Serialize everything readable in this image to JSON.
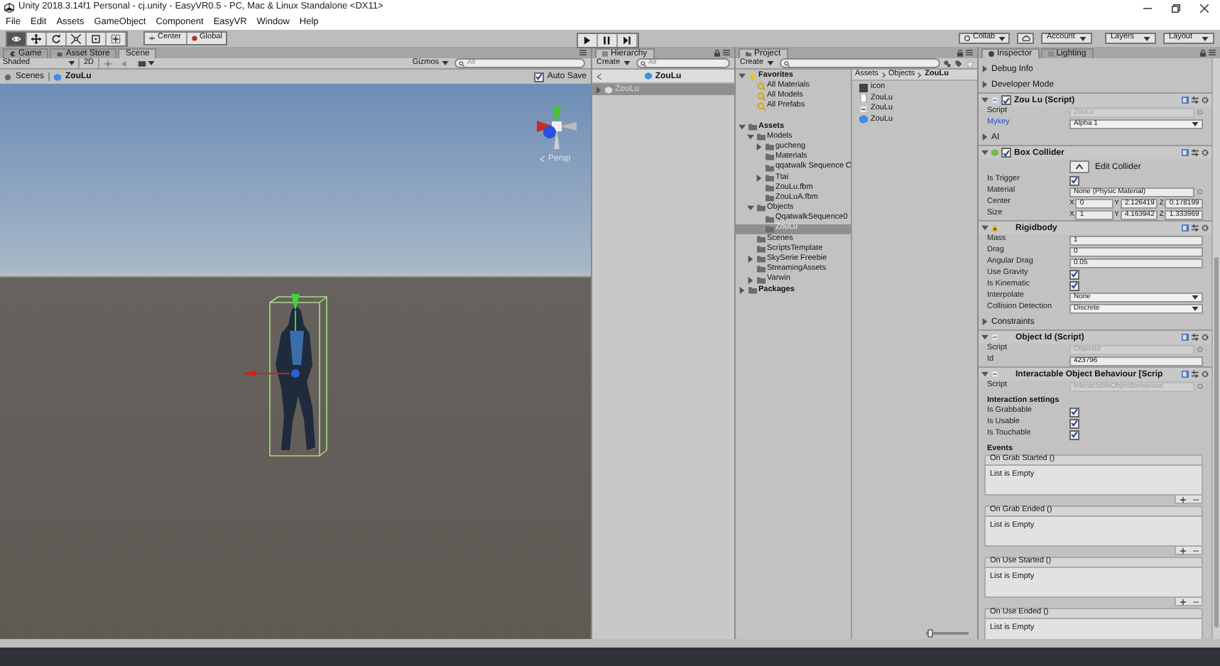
{
  "window": {
    "title": "Unity 2018.3.14f1 Personal - cj.unity - EasyVR0.5 - PC, Mac & Linux Standalone <DX11>"
  },
  "menu": [
    "File",
    "Edit",
    "Assets",
    "GameObject",
    "Component",
    "EasyVR",
    "Window",
    "Help"
  ],
  "toolbar": {
    "tools": [
      {
        "kind": "view",
        "selected": true
      },
      {
        "kind": "move",
        "selected": false
      },
      {
        "kind": "rotate",
        "selected": false
      },
      {
        "kind": "scale",
        "selected": false
      },
      {
        "kind": "rect",
        "selected": false
      },
      {
        "kind": "transform",
        "selected": false
      }
    ],
    "pivot": "Center",
    "space": "Global",
    "play": [
      {
        "kind": "play"
      },
      {
        "kind": "pause"
      },
      {
        "kind": "step"
      }
    ],
    "collab": "Collab",
    "account": "Account",
    "layers": "Layers",
    "layout": "Layout"
  },
  "scene": {
    "tabs": [
      {
        "label": "Game",
        "kind": "game",
        "selected": false
      },
      {
        "label": "Asset Store",
        "kind": "store",
        "selected": false
      },
      {
        "label": "Scene",
        "kind": "scene",
        "selected": true
      }
    ],
    "shading": "Shaded",
    "mode_2d": "2D",
    "gizmos": "Gizmos",
    "search": {
      "placeholder": "All"
    },
    "breadcrumb": [
      "Scenes",
      "ZouLu"
    ],
    "auto_save": {
      "label": "Auto Save",
      "checked": true
    },
    "projection": "Persp"
  },
  "hierarchy": {
    "tab": "Hierarchy",
    "create": "Create",
    "search": {
      "placeholder": "All"
    },
    "scene_header": "ZouLu",
    "items": [
      {
        "label": "ZouLu",
        "selected": true,
        "expanded": false
      }
    ]
  },
  "project": {
    "tab": "Project",
    "create": "Create",
    "tree": [
      {
        "label": "Favorites",
        "kind": "favorites",
        "expanded": true,
        "children": [
          {
            "label": "All Materials",
            "kind": "search"
          },
          {
            "label": "All Models",
            "kind": "search"
          },
          {
            "label": "All Prefabs",
            "kind": "search"
          }
        ]
      },
      {
        "label": "Assets",
        "kind": "root",
        "expanded": true,
        "children": [
          {
            "label": "Models",
            "kind": "folder",
            "expanded": true,
            "children": [
              {
                "label": "gucheng",
                "kind": "folder",
                "expanded": false
              },
              {
                "label": "Materials",
                "kind": "folder"
              },
              {
                "label": "qqatwalk Sequence C",
                "kind": "folder"
              },
              {
                "label": "Ttai",
                "kind": "folder",
                "expanded": false
              },
              {
                "label": "ZouLu.fbm",
                "kind": "folder"
              },
              {
                "label": "ZouLuA.fbm",
                "kind": "folder"
              }
            ]
          },
          {
            "label": "Objects",
            "kind": "folder",
            "expanded": true,
            "children": [
              {
                "label": "QqatwalkSequence0",
                "kind": "folder"
              },
              {
                "label": "ZouLu",
                "kind": "folder",
                "selected": true
              }
            ]
          },
          {
            "label": "Scenes",
            "kind": "folder"
          },
          {
            "label": "ScriptsTemplate",
            "kind": "folder"
          },
          {
            "label": "SkySerie Freebie",
            "kind": "folder",
            "expanded": false
          },
          {
            "label": "StreamingAssets",
            "kind": "folder"
          },
          {
            "label": "Varwin",
            "kind": "folder",
            "expanded": false
          }
        ]
      },
      {
        "label": "Packages",
        "kind": "root",
        "expanded": false
      }
    ],
    "path": [
      "Assets",
      "Objects",
      "ZouLu"
    ],
    "zoom_slider": {
      "level": 0.05
    },
    "files": [
      {
        "label": "icon",
        "kind": "image"
      },
      {
        "label": "ZouLu",
        "kind": "document"
      },
      {
        "label": "ZouLu",
        "kind": "script"
      },
      {
        "label": "ZouLu",
        "kind": "prefab"
      }
    ]
  },
  "inspector": {
    "tabs": [
      {
        "label": "Inspector",
        "selected": true
      },
      {
        "label": "Lighting",
        "selected": false
      }
    ],
    "items": [
      {
        "kind": "foldout",
        "label": "Debug Info",
        "expanded": false
      },
      {
        "kind": "foldout",
        "label": "Developer Mode",
        "expanded": false
      },
      {
        "kind": "component",
        "title": "Zou Lu (Script)",
        "enabled": true,
        "expanded": true,
        "fields": [
          {
            "kind": "object",
            "label": "Script",
            "value": "ZouLu",
            "disabled": true
          },
          {
            "kind": "dropdown",
            "label": "Mykey",
            "value": "Alpha 1",
            "overridden": true
          }
        ]
      },
      {
        "kind": "foldout",
        "label": "AI",
        "expanded": false
      },
      {
        "kind": "component",
        "title": "Box Collider",
        "enabled": true,
        "expanded": true,
        "fields": [
          {
            "kind": "button",
            "label": "Edit Collider"
          },
          {
            "kind": "checkbox",
            "label": "Is Trigger",
            "checked": true
          },
          {
            "kind": "object",
            "label": "Material",
            "value": "None (Physic Material)",
            "disabled": false
          },
          {
            "kind": "vector",
            "label": "Center",
            "axes": [
              {
                "axis": "X",
                "value": "0"
              },
              {
                "axis": "Y",
                "value": "2.126419"
              },
              {
                "axis": "Z",
                "value": "0.178199"
              }
            ]
          },
          {
            "kind": "vector",
            "label": "Size",
            "axes": [
              {
                "axis": "X",
                "value": "1"
              },
              {
                "axis": "Y",
                "value": "4.163942"
              },
              {
                "axis": "Z",
                "value": "1.333969"
              }
            ]
          }
        ]
      },
      {
        "kind": "component",
        "title": "Rigidbody",
        "expanded": true,
        "fields": [
          {
            "kind": "text",
            "label": "Mass",
            "value": "1"
          },
          {
            "kind": "text",
            "label": "Drag",
            "value": "0"
          },
          {
            "kind": "text",
            "label": "Angular Drag",
            "value": "0.05"
          },
          {
            "kind": "checkbox",
            "label": "Use Gravity",
            "checked": true
          },
          {
            "kind": "checkbox",
            "label": "Is Kinematic",
            "checked": true
          },
          {
            "kind": "dropdown",
            "label": "Interpolate",
            "value": "None",
            "overridden": false
          },
          {
            "kind": "dropdown",
            "label": "Collision Detection",
            "value": "Discrete",
            "overridden": false
          },
          {
            "kind": "foldout",
            "label": "Constraints",
            "expanded": false
          }
        ]
      },
      {
        "kind": "component",
        "title": "Object Id (Script)",
        "expanded": true,
        "fields": [
          {
            "kind": "object",
            "label": "Script",
            "value": "ObjectId",
            "disabled": true
          },
          {
            "kind": "text",
            "label": "Id",
            "value": "423796"
          }
        ]
      },
      {
        "kind": "component",
        "title": "Interactable Object Behaviour [Scrip",
        "expanded": true,
        "fields": [
          {
            "kind": "object",
            "label": "Script",
            "value": "InteractableObjectBehaviour",
            "disabled": true
          },
          {
            "kind": "heading",
            "label": "Interaction settings"
          },
          {
            "kind": "checkbox",
            "label": "Is Grabbable",
            "checked": true
          },
          {
            "kind": "checkbox",
            "label": "Is Usable",
            "checked": true
          },
          {
            "kind": "checkbox",
            "label": "Is Touchable",
            "checked": true
          },
          {
            "kind": "heading",
            "label": "Events"
          },
          {
            "kind": "event",
            "label": "On Grab Started ()",
            "value": "List is Empty"
          },
          {
            "kind": "event",
            "label": "On Grab Ended ()",
            "value": "List is Empty"
          },
          {
            "kind": "event",
            "label": "On Use Started ()",
            "value": "List is Empty"
          },
          {
            "kind": "event",
            "label": "On Use Ended ()",
            "value": "List is Empty"
          }
        ]
      }
    ]
  }
}
